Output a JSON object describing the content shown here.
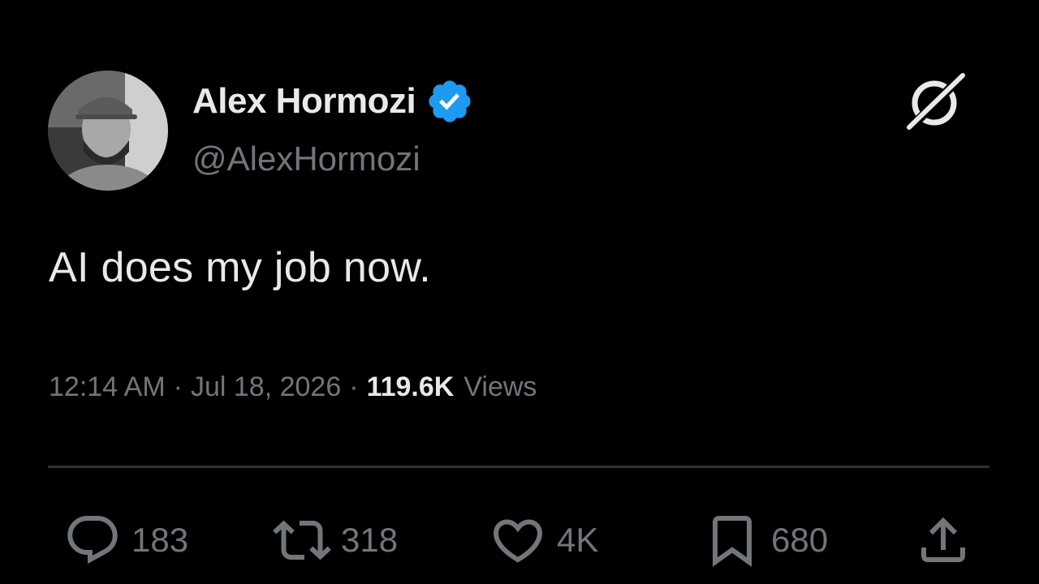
{
  "author": {
    "display_name": "Alex Hormozi",
    "handle": "@AlexHormozi",
    "verified": true
  },
  "tweet": {
    "text": "AI does my job now.",
    "time": "12:14 AM",
    "date": "Jul 18, 2026",
    "views_count": "119.6K",
    "views_label": "Views"
  },
  "actions": {
    "replies": "183",
    "retweets": "318",
    "likes": "4K",
    "bookmarks": "680"
  },
  "icons": {
    "verified": "verified-badge-icon",
    "grok": "grok-icon",
    "reply": "reply-icon",
    "retweet": "retweet-icon",
    "like": "heart-icon",
    "bookmark": "bookmark-icon",
    "share": "share-icon"
  },
  "colors": {
    "background": "#000000",
    "primary_text": "#e7e9ea",
    "secondary_text": "#71767b",
    "verified_blue": "#1d9bf0",
    "divider": "#2f3336"
  }
}
